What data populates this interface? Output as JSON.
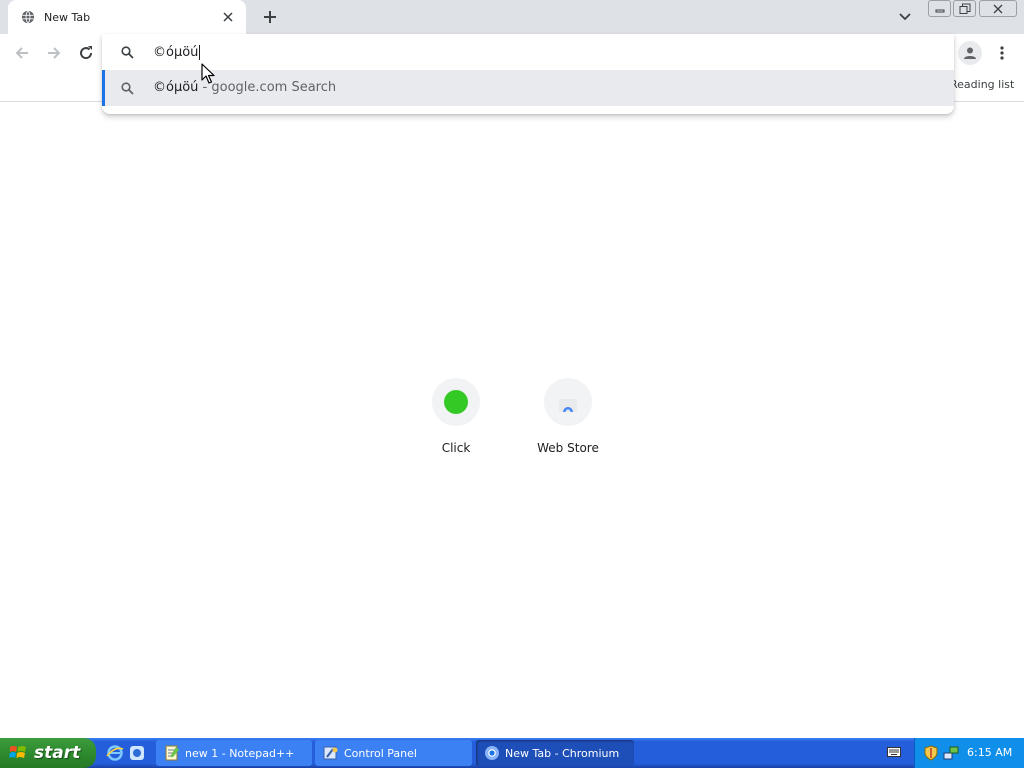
{
  "browser": {
    "tab": {
      "title": "New Tab",
      "favicon": "globe-icon"
    },
    "new_tab_icon": "plus-icon",
    "toolbar": {
      "reading_list_label": "Reading list"
    }
  },
  "omnibox": {
    "input_value": "©όμöú",
    "suggestion": {
      "query": "©όμöú",
      "separator": " - ",
      "provider": "google.com Search"
    }
  },
  "shortcuts": [
    {
      "label": "Click",
      "color": "#34c924"
    },
    {
      "label": "Web Store",
      "color": "#4285f4"
    }
  ],
  "taskbar": {
    "start_label": "start",
    "tasks": [
      {
        "label": "new 1 - Notepad++"
      },
      {
        "label": "Control Panel"
      },
      {
        "label": "New Tab - Chromium"
      }
    ],
    "clock": "6:15 AM"
  },
  "colors": {
    "accent": "#1a73e8",
    "taskbar": "#245edb",
    "start": "#2e8b2e"
  }
}
